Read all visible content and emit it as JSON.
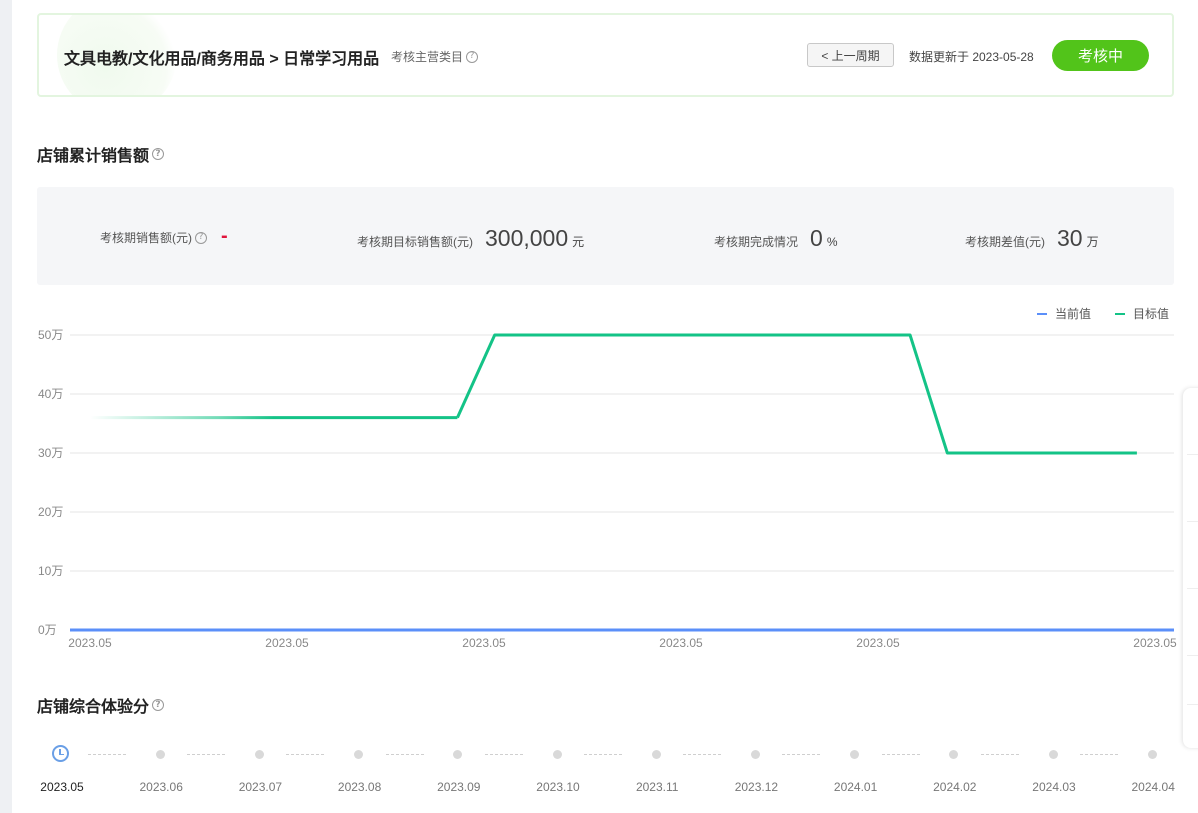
{
  "header": {
    "category_path": "文具电教/文化用品/商务用品 > 日常学习用品",
    "category_type": "考核主营类目",
    "prev_period_label": "< 上一周期",
    "update_text": "数据更新于 2023-05-28",
    "status_label": "考核中",
    "status_color": "#52c41a"
  },
  "sales_section": {
    "title": "店铺累计销售额",
    "stats": [
      {
        "label": "考核期销售额(元)",
        "value": "-",
        "unit": ""
      },
      {
        "label": "考核期目标销售额(元)",
        "value": "300,000",
        "unit": "元"
      },
      {
        "label": "考核期完成情况",
        "value": "0",
        "unit": "%"
      },
      {
        "label": "考核期差值(元)",
        "value": "30",
        "unit": "万"
      }
    ]
  },
  "chart_data": {
    "type": "line",
    "y_ticks": [
      "0万",
      "10万",
      "20万",
      "30万",
      "40万",
      "50万"
    ],
    "ylim": [
      0,
      50
    ],
    "x_tick_labels": [
      "2023.05",
      "2023.05",
      "2023.05",
      "2023.05",
      "2023.05",
      "2023.05"
    ],
    "grid": true,
    "legend_position": "top-right",
    "series": [
      {
        "name": "当前值",
        "color": "#5b8ff9",
        "points": [
          [
            0,
            0
          ],
          [
            1,
            0
          ]
        ]
      },
      {
        "name": "目标值",
        "color": "#14c387",
        "points": [
          [
            0,
            36
          ],
          [
            0.345,
            36
          ],
          [
            0.38,
            50
          ],
          [
            0.77,
            50
          ],
          [
            0.805,
            30
          ],
          [
            0.983,
            30
          ]
        ]
      }
    ]
  },
  "experience_section": {
    "title": "店铺综合体验分",
    "months": [
      "2023.05",
      "2023.06",
      "2023.07",
      "2023.08",
      "2023.09",
      "2023.10",
      "2023.11",
      "2023.12",
      "2024.01",
      "2024.02",
      "2024.03",
      "2024.04"
    ]
  }
}
